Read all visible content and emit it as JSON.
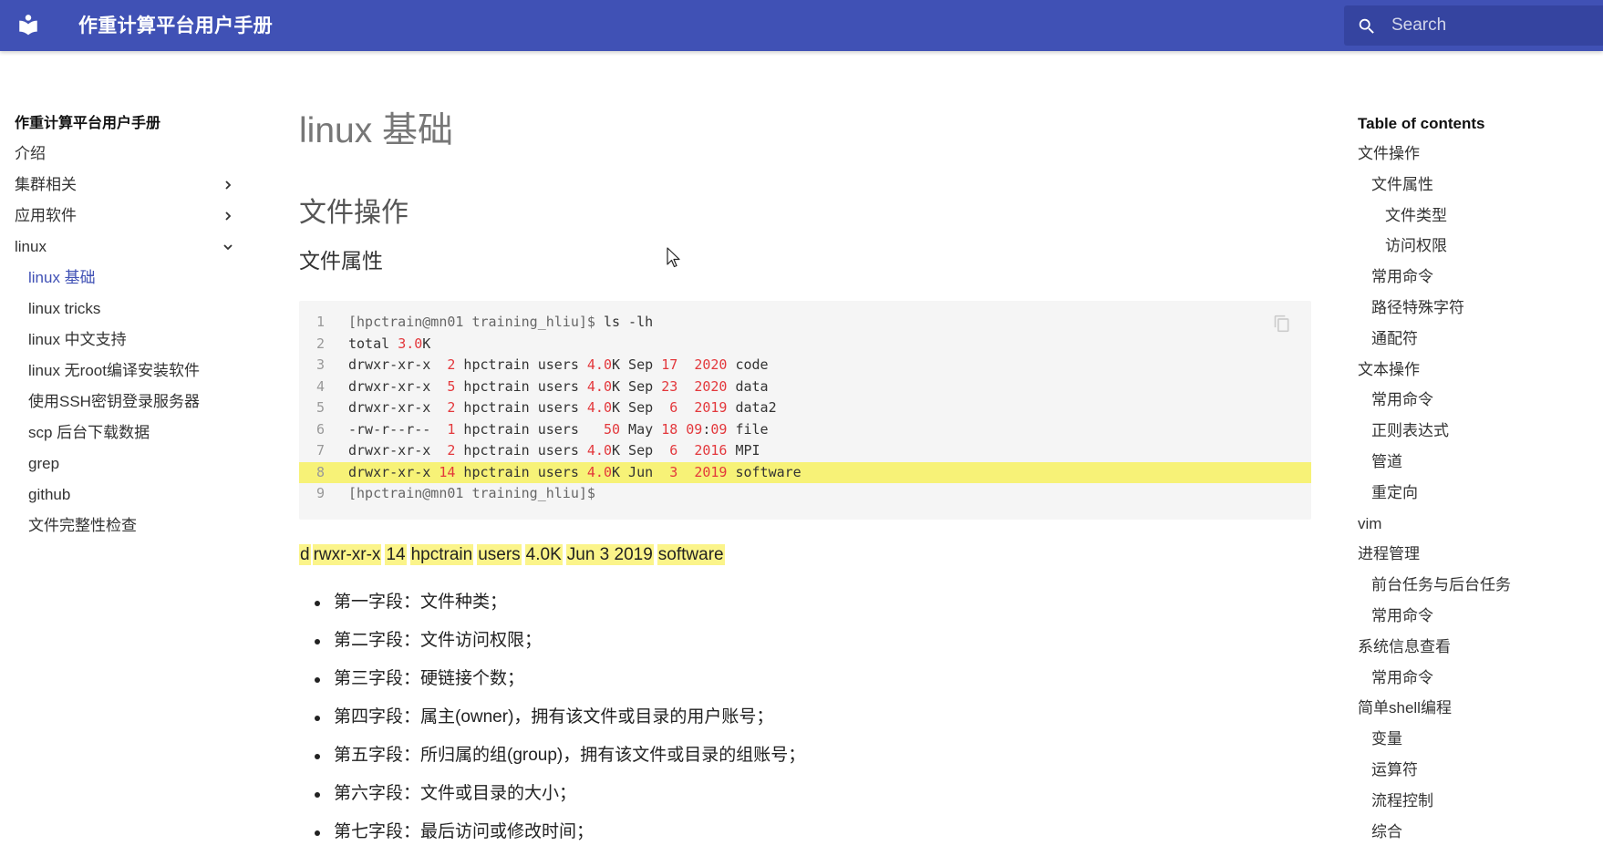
{
  "header": {
    "site_title": "作重计算平台用户手册",
    "search_placeholder": "Search",
    "brand_color": "#4051b5"
  },
  "nav": {
    "title": "作重计算平台用户手册",
    "items": [
      {
        "label": "介绍",
        "level": 1,
        "chevron": "none"
      },
      {
        "label": "集群相关",
        "level": 1,
        "chevron": "right"
      },
      {
        "label": "应用软件",
        "level": 1,
        "chevron": "right"
      },
      {
        "label": "linux",
        "level": 1,
        "chevron": "down"
      },
      {
        "label": "linux 基础",
        "level": 2,
        "active": true
      },
      {
        "label": "linux tricks",
        "level": 2
      },
      {
        "label": "linux 中文支持",
        "level": 2
      },
      {
        "label": "linux 无root编译安装软件",
        "level": 2
      },
      {
        "label": "使用SSH密钥登录服务器",
        "level": 2
      },
      {
        "label": "scp 后台下载数据",
        "level": 2
      },
      {
        "label": "grep",
        "level": 2
      },
      {
        "label": "github",
        "level": 2
      },
      {
        "label": "文件完整性检查",
        "level": 2
      }
    ]
  },
  "main": {
    "h1": "linux 基础",
    "h2": "文件操作",
    "h3": "文件属性",
    "code_lines": [
      {
        "n": "1",
        "text": "[hpctrain@mn01 training_hliu]$ ls -lh"
      },
      {
        "n": "2",
        "text": "total 3.0K"
      },
      {
        "n": "3",
        "text": "drwxr-xr-x  2 hpctrain users 4.0K Sep 17  2020 code"
      },
      {
        "n": "4",
        "text": "drwxr-xr-x  5 hpctrain users 4.0K Sep 23  2020 data"
      },
      {
        "n": "5",
        "text": "drwxr-xr-x  2 hpctrain users 4.0K Sep  6  2019 data2"
      },
      {
        "n": "6",
        "text": "-rw-r--r--  1 hpctrain users   50 May 18 09:09 file"
      },
      {
        "n": "7",
        "text": "drwxr-xr-x  2 hpctrain users 4.0K Sep  6  2016 MPI"
      },
      {
        "n": "8",
        "text": "drwxr-xr-x 14 hpctrain users 4.0K Jun  3  2019 software",
        "highlight": true
      },
      {
        "n": "9",
        "text": "[hpctrain@mn01 training_hliu]$"
      }
    ],
    "fields": [
      "d",
      "rwxr-xr-x",
      "14",
      "hpctrain",
      "users",
      "4.0K",
      "Jun 3 2019",
      "software"
    ],
    "bullets": [
      "第一字段：文件种类；",
      "第二字段：文件访问权限；",
      "第三字段：硬链接个数；",
      "第四字段：属主(owner)，拥有该文件或目录的用户账号；",
      "第五字段：所归属的组(group)，拥有该文件或目录的组账号；",
      "第六字段：文件或目录的大小；",
      "第七字段：最后访问或修改时间；"
    ]
  },
  "toc": {
    "title": "Table of contents",
    "items": [
      {
        "label": "文件操作",
        "level": 1
      },
      {
        "label": "文件属性",
        "level": 2
      },
      {
        "label": "文件类型",
        "level": 3
      },
      {
        "label": "访问权限",
        "level": 3
      },
      {
        "label": "常用命令",
        "level": 2
      },
      {
        "label": "路径特殊字符",
        "level": 2
      },
      {
        "label": "通配符",
        "level": 2
      },
      {
        "label": "文本操作",
        "level": 1
      },
      {
        "label": "常用命令",
        "level": 2
      },
      {
        "label": "正则表达式",
        "level": 2
      },
      {
        "label": "管道",
        "level": 2
      },
      {
        "label": "重定向",
        "level": 2
      },
      {
        "label": "vim",
        "level": 1
      },
      {
        "label": "进程管理",
        "level": 1
      },
      {
        "label": "前台任务与后台任务",
        "level": 2
      },
      {
        "label": "常用命令",
        "level": 2
      },
      {
        "label": "系统信息查看",
        "level": 1
      },
      {
        "label": "常用命令",
        "level": 2
      },
      {
        "label": "简单shell编程",
        "level": 1
      },
      {
        "label": "变量",
        "level": 2
      },
      {
        "label": "运算符",
        "level": 2
      },
      {
        "label": "流程控制",
        "level": 2
      },
      {
        "label": "综合",
        "level": 2
      }
    ]
  }
}
